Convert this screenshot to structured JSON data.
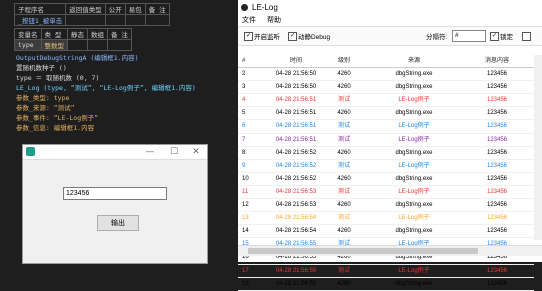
{
  "editor": {
    "sig_header": [
      "子程序名",
      "返回值类型",
      "公开",
      "易包",
      "备 注"
    ],
    "sig_row": [
      "_按钮1_被单击",
      "",
      "",
      "",
      ""
    ],
    "var_header": [
      "变量名",
      "类 型",
      "静态",
      "数组",
      "备 注"
    ],
    "var_row": [
      "type",
      "整数型",
      "",
      "",
      ""
    ],
    "code": [
      {
        "text": "OutputDebugStringA (编辑框1.内容)",
        "cls": "kw-blue"
      },
      {
        "text": "置随机数种子 ()",
        "cls": ""
      },
      {
        "text": "type ＝ 取随机数 (0, 7)",
        "cls": ""
      },
      {
        "text": "LE_Log (type, “测试”, “LE-Log例子”, 编辑框1.内容)",
        "cls": "kw-cyan"
      },
      {
        "text": "    参数_类型: type",
        "cls": "param"
      },
      {
        "text": "    参数_来源: “测试”",
        "cls": "param"
      },
      {
        "text": "    参数_事件: “LE-Log例子”",
        "cls": "param"
      },
      {
        "text": "    参数_信息: 编辑框1.内容",
        "cls": "param"
      }
    ]
  },
  "testwin": {
    "input_value": "123456",
    "button_label": "输出",
    "minimize": "—",
    "maximize": "☐",
    "close": "✕"
  },
  "lelog": {
    "title": "LE-Log",
    "menu": [
      "文件",
      "帮助"
    ],
    "toolbar": {
      "top_label": "置顶",
      "auto_scroll_label": "开启监听",
      "debug_label": "动静Debug",
      "interval_label": "分隔符:",
      "interval_value": "#",
      "lock_label": "锁定"
    },
    "columns": [
      "#",
      "时间",
      "级别",
      "来源",
      "消息内容"
    ],
    "rows": [
      {
        "n": "2",
        "time": "04-28 21:56:50",
        "lvl": "4260",
        "src": "dbgString.exe",
        "msg": "123456",
        "color": "#000000"
      },
      {
        "n": "3",
        "time": "04-28 21:56:50",
        "lvl": "4260",
        "src": "dbgString.exe",
        "msg": "123456",
        "color": "#000000"
      },
      {
        "n": "4",
        "time": "04-28 21:56:51",
        "lvl": "测试",
        "src": "LE-Log例子",
        "msg": "123456",
        "color": "#e53935"
      },
      {
        "n": "5",
        "time": "04-28 21:56:51",
        "lvl": "4260",
        "src": "dbgString.exe",
        "msg": "123456",
        "color": "#000000"
      },
      {
        "n": "6",
        "time": "04-28 21:56:51",
        "lvl": "测试",
        "src": "LE-Log例子",
        "msg": "123456",
        "color": "#1e88e5"
      },
      {
        "n": "7",
        "time": "04-28 21:56:51",
        "lvl": "测试",
        "src": "LE-Log例子",
        "msg": "123456",
        "color": "#8e24aa"
      },
      {
        "n": "8",
        "time": "04-28 21:56:52",
        "lvl": "4260",
        "src": "dbgString.exe",
        "msg": "123456",
        "color": "#000000"
      },
      {
        "n": "9",
        "time": "04-28 21:56:52",
        "lvl": "测试",
        "src": "LE-Log例子",
        "msg": "123456",
        "color": "#1e88e5"
      },
      {
        "n": "10",
        "time": "04-28 21:56:52",
        "lvl": "4260",
        "src": "dbgString.exe",
        "msg": "123456",
        "color": "#000000"
      },
      {
        "n": "11",
        "time": "04-28 21:56:53",
        "lvl": "测试",
        "src": "LE-Log例子",
        "msg": "123456",
        "color": "#e53935"
      },
      {
        "n": "12",
        "time": "04-28 21:56:53",
        "lvl": "4260",
        "src": "dbgString.exe",
        "msg": "123456",
        "color": "#000000"
      },
      {
        "n": "13",
        "time": "04-28 21:56:54",
        "lvl": "测试",
        "src": "LE-Log例子",
        "msg": "123456",
        "color": "#f9a825"
      },
      {
        "n": "14",
        "time": "04-28 21:56:54",
        "lvl": "4260",
        "src": "dbgString.exe",
        "msg": "123456",
        "color": "#000000"
      },
      {
        "n": "15",
        "time": "04-28 21:56:55",
        "lvl": "测试",
        "src": "LE-Log例子",
        "msg": "123456",
        "color": "#1e88e5"
      },
      {
        "n": "16",
        "time": "04-28 21:56:55",
        "lvl": "4260",
        "src": "dbgString.exe",
        "msg": "123456",
        "color": "#000000"
      },
      {
        "n": "17",
        "time": "04-28 21:56:55",
        "lvl": "测试",
        "src": "LE-Log例子",
        "msg": "123456",
        "color": "#e53935"
      },
      {
        "n": "18",
        "time": "04-28 21:56:55",
        "lvl": "4260",
        "src": "dbgString.exe",
        "msg": "123456",
        "color": "#000000"
      }
    ]
  }
}
